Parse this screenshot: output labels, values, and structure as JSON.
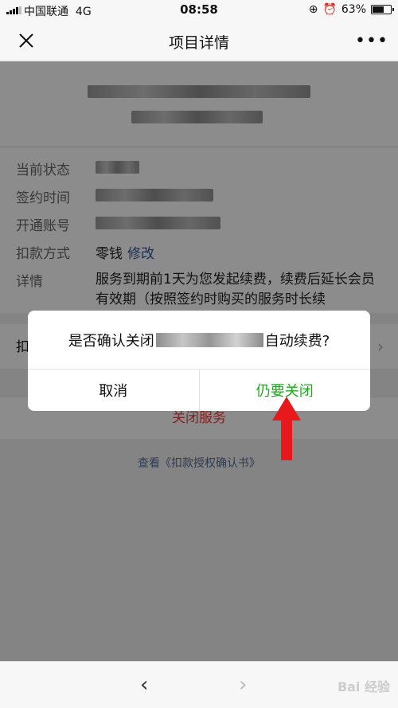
{
  "status_bar": {
    "carrier": "中国联通",
    "network": "4G",
    "time": "08:58",
    "battery_percent": "63%",
    "battery_level": 0.63
  },
  "nav": {
    "close_icon": "close-icon",
    "title": "项目详情",
    "more_icon": "more-icon"
  },
  "details": {
    "rows": [
      {
        "label": "当前状态"
      },
      {
        "label": "签约时间"
      },
      {
        "label": "开通账号"
      },
      {
        "label": "扣款方式",
        "value": "零钱",
        "link": "修改"
      },
      {
        "label": "详情",
        "value": "服务到期前1天为您发起续费，续费后延长会员有效期（按照签约时购买的服务时长续"
      }
    ]
  },
  "section2": {
    "label": "扣",
    "arrow": "›"
  },
  "close_service": "关闭服务",
  "agreement_link": "查看《扣款授权确认书》",
  "dialog": {
    "message_prefix": "是否确认关闭",
    "message_suffix": "自动续费?",
    "cancel": "取消",
    "confirm": "仍要关闭"
  },
  "toolbar": {
    "back_icon": "‹",
    "forward_icon": "›",
    "watermark": "Bai 经验"
  },
  "colors": {
    "link": "#2d57a5",
    "confirm_green": "#1aad19",
    "close_red": "#e64340",
    "annotation_red": "#e8191d"
  }
}
